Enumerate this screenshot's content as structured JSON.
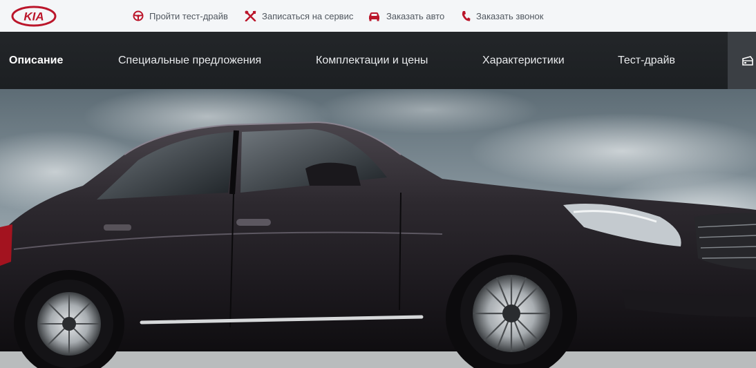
{
  "brand": {
    "logo_text": "KIA",
    "accent": "#bb162b"
  },
  "topbar": {
    "links": [
      {
        "label": "Пройти тест-драйв",
        "icon": "steering-wheel-icon"
      },
      {
        "label": "Записаться на сервис",
        "icon": "wrench-tools-icon"
      },
      {
        "label": "Заказать авто",
        "icon": "car-icon"
      },
      {
        "label": "Заказать звонок",
        "icon": "phone-icon"
      }
    ]
  },
  "nav": {
    "items": [
      {
        "label": "Описание",
        "active": true
      },
      {
        "label": "Специальные предложения",
        "active": false
      },
      {
        "label": "Комплектации и цены",
        "active": false
      },
      {
        "label": "Характеристики",
        "active": false
      },
      {
        "label": "Тест-драйв",
        "active": false
      }
    ],
    "tool_icon": "calculator-icon"
  },
  "hero": {
    "subject": "dark-sedan-car-image"
  },
  "colors": {
    "topbar_bg": "#f4f6f8",
    "nav_bg": "#1f2225",
    "nav_text": "#e9ebed",
    "icon_red": "#bb162b"
  }
}
